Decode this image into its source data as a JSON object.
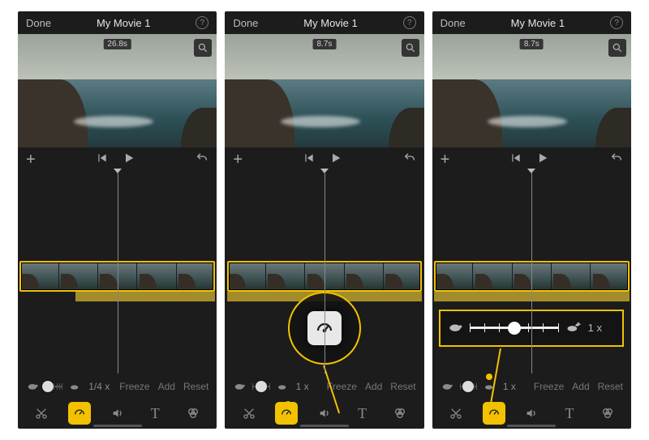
{
  "accent": "#f2c200",
  "header": {
    "done": "Done",
    "title": "My Movie 1"
  },
  "screens": [
    {
      "duration": "26.8s",
      "speed_value": "1/4 x",
      "speed_knob_pct": 14,
      "freeze": "Freeze",
      "add": "Add",
      "reset": "Reset",
      "active_tool": "speed",
      "clip_sel": {
        "left_pct": 1,
        "width_pct": 98
      },
      "audio": {
        "left_pct": 29,
        "width_pct": 70
      }
    },
    {
      "duration": "8.7s",
      "speed_value": "1 x",
      "speed_knob_pct": 48,
      "freeze": "Freeze",
      "add": "Add",
      "reset": "Reset",
      "active_tool": "speed",
      "clip_sel": {
        "left_pct": 1,
        "width_pct": 98
      },
      "audio": {
        "left_pct": 1,
        "width_pct": 98
      }
    },
    {
      "duration": "8.7s",
      "speed_value": "1 x",
      "speed_knob_pct": 48,
      "freeze": "Freeze",
      "add": "Add",
      "reset": "Reset",
      "active_tool": "speed",
      "clip_sel": {
        "left_pct": 1,
        "width_pct": 98
      },
      "audio": {
        "left_pct": 1,
        "width_pct": 98
      }
    }
  ],
  "big_slider_label": "1 x",
  "tools": {
    "cut": "cut-icon",
    "speed": "speedometer-icon",
    "volume": "volume-icon",
    "text": "text-icon",
    "filters": "filters-icon"
  }
}
